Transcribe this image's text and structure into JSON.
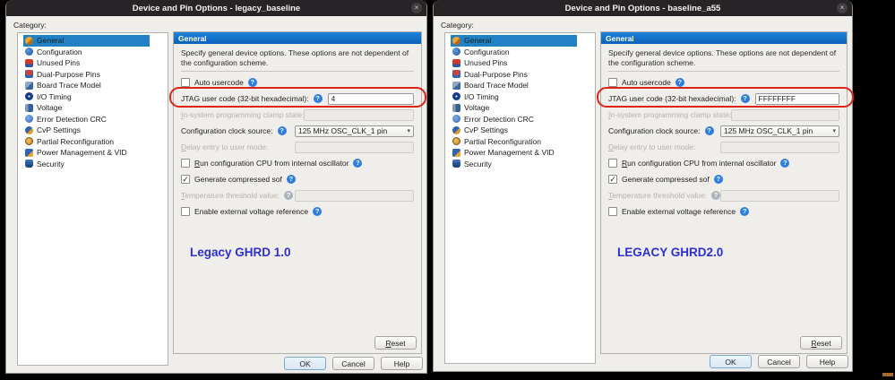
{
  "icons": {
    "close": "×",
    "help": "?",
    "dropdown": "▾",
    "check": "✓"
  },
  "dialogs": [
    {
      "title": "Device and Pin Options - legacy_baseline",
      "category_label": "Category:",
      "categories": [
        "General",
        "Configuration",
        "Unused Pins",
        "Dual-Purpose Pins",
        "Board Trace Model",
        "I/O Timing",
        "Voltage",
        "Error Detection CRC",
        "CvP Settings",
        "Partial Reconfiguration",
        "Power Management & VID",
        "Security"
      ],
      "selected_category": "General",
      "panel": {
        "header": "General",
        "description": "Specify general device options. These options are not dependent of the configuration scheme.",
        "auto_usercode_label": "Auto usercode",
        "auto_usercode_checked": false,
        "jtag_label": "JTAG user code (32-bit hexadecimal):",
        "jtag_value": "4",
        "clamp_label": "In-system programming clamp state:",
        "clamp_value": "",
        "clock_label": "Configuration clock source:",
        "clock_value": "125 MHz OSC_CLK_1 pin",
        "delay_label": "Delay entry to user mode:",
        "delay_value": "",
        "run_cpu_label": "Run configuration CPU from internal oscillator",
        "run_cpu_checked": false,
        "compressed_label": "Generate compressed sof",
        "compressed_checked": true,
        "temp_label": "Temperature threshold value:",
        "temp_value": "",
        "ext_ref_label": "Enable external voltage reference",
        "ext_ref_checked": false,
        "annotation": "Legacy GHRD 1.0",
        "reset_label": "Reset"
      },
      "buttons": {
        "ok": "OK",
        "cancel": "Cancel",
        "help": "Help"
      }
    },
    {
      "title": "Device and Pin Options - baseline_a55",
      "category_label": "Category:",
      "categories": [
        "General",
        "Configuration",
        "Unused Pins",
        "Dual-Purpose Pins",
        "Board Trace Model",
        "I/O Timing",
        "Voltage",
        "Error Detection CRC",
        "CvP Settings",
        "Partial Reconfiguration",
        "Power Management & VID",
        "Security"
      ],
      "selected_category": "General",
      "panel": {
        "header": "General",
        "description": "Specify general device options. These options are not dependent of the configuration scheme.",
        "auto_usercode_label": "Auto usercode",
        "auto_usercode_checked": false,
        "jtag_label": "JTAG user code (32-bit hexadecimal):",
        "jtag_value": "FFFFFFFF",
        "clamp_label": "In-system programming clamp state:",
        "clamp_value": "",
        "clock_label": "Configuration clock source:",
        "clock_value": "125 MHz OSC_CLK_1 pin",
        "delay_label": "Delay entry to user mode:",
        "delay_value": "",
        "run_cpu_label": "Run configuration CPU from internal oscillator",
        "run_cpu_checked": false,
        "compressed_label": "Generate compressed sof",
        "compressed_checked": true,
        "temp_label": "Temperature threshold value:",
        "temp_value": "",
        "ext_ref_label": "Enable external voltage reference",
        "ext_ref_checked": false,
        "annotation": "LEGACY GHRD2.0",
        "reset_label": "Reset"
      },
      "buttons": {
        "ok": "OK",
        "cancel": "Cancel",
        "help": "Help"
      }
    }
  ]
}
